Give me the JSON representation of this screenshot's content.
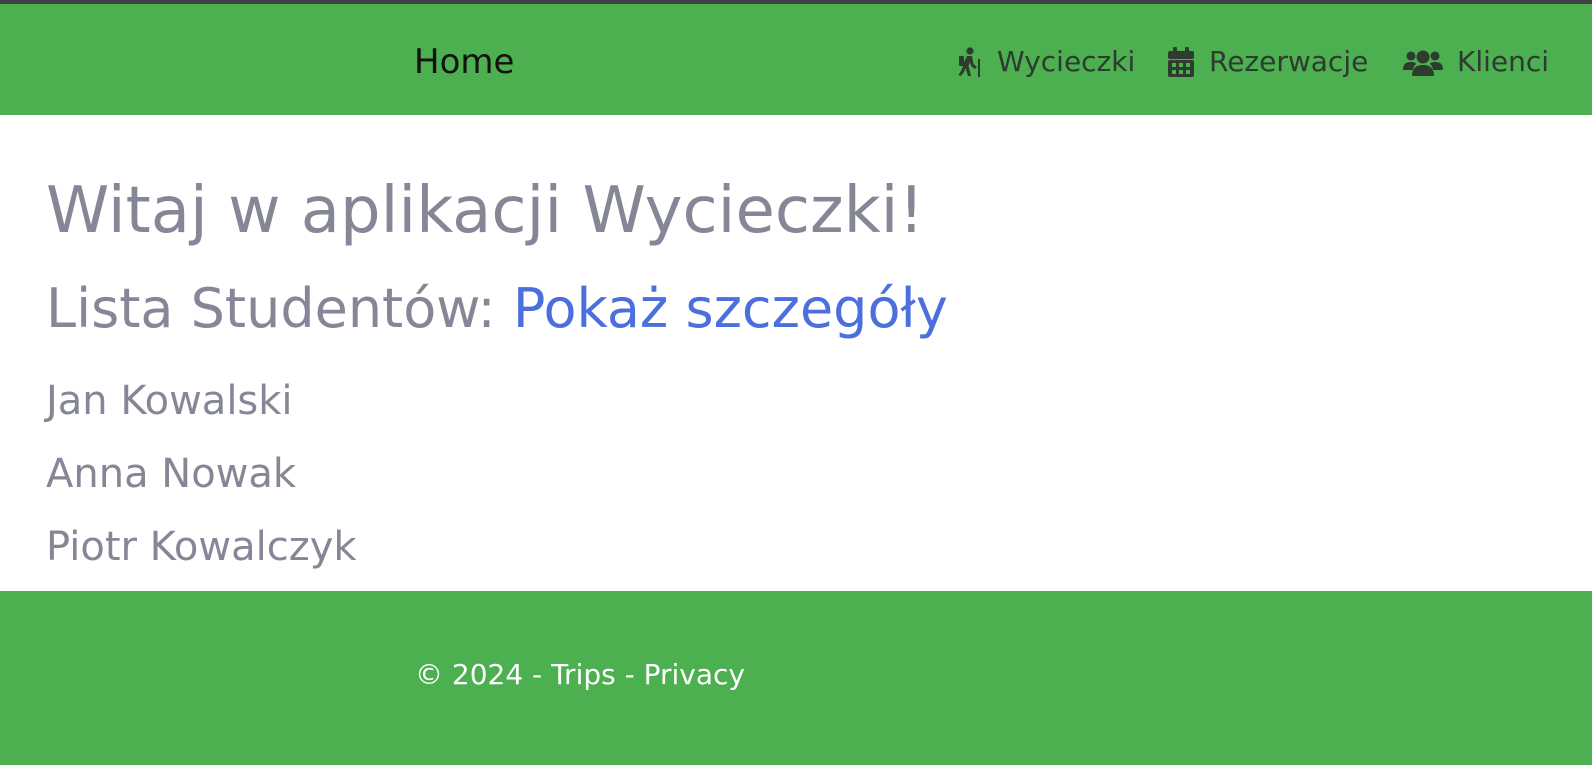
{
  "navbar": {
    "brand": "Home",
    "items": [
      {
        "label": "Wycieczki",
        "icon": "hiking-icon"
      },
      {
        "label": "Rezerwacje",
        "icon": "calendar-icon"
      },
      {
        "label": "Klienci",
        "icon": "users-icon"
      }
    ]
  },
  "main": {
    "title": "Witaj w aplikacji Wycieczki!",
    "list_heading": "Lista Studentów:",
    "details_link": "Pokaż szczegóły",
    "students": [
      "Jan Kowalski",
      "Anna Nowak",
      "Piotr Kowalczyk"
    ]
  },
  "footer": {
    "copyright": "© 2024 - Trips - ",
    "privacy_link": "Privacy"
  },
  "colors": {
    "primary_green": "#4caf50",
    "top_strip": "#3f3f44",
    "text_muted": "#858797",
    "link_blue": "#4b6fdc"
  }
}
